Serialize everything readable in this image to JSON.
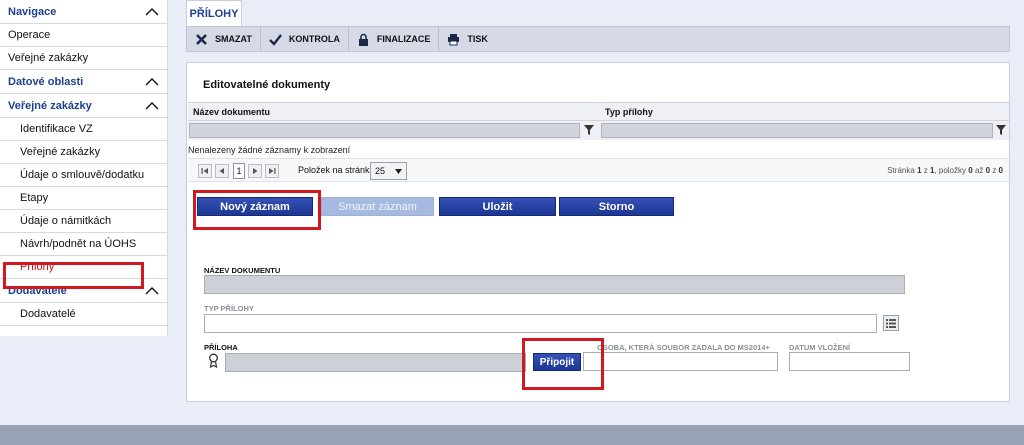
{
  "sidebar": {
    "sections": [
      {
        "title": "Navigace",
        "items": [
          {
            "label": "Operace"
          },
          {
            "label": "Veřejné zakázky"
          }
        ]
      },
      {
        "title": "Datové oblasti",
        "items": []
      },
      {
        "title": "Veřejné zakázky",
        "items": [
          {
            "label": "Identifikace VZ"
          },
          {
            "label": "Veřejné zakázky"
          },
          {
            "label": "Údaje o smlouvě/dodatku"
          },
          {
            "label": "Etapy"
          },
          {
            "label": "Údaje o námitkách"
          },
          {
            "label": "Návrh/podnět na ÚOHS"
          },
          {
            "label": "Přílohy",
            "active": true
          }
        ]
      },
      {
        "title": "Dodavatelé",
        "items": [
          {
            "label": "Dodavatelé"
          }
        ]
      }
    ]
  },
  "tab": {
    "label": "PŘÍLOHY"
  },
  "toolbar": {
    "delete": "SMAZAT",
    "check": "KONTROLA",
    "finalize": "FINALIZACE",
    "print": "TISK"
  },
  "grid": {
    "title": "Editovatelné dokumenty",
    "columns": [
      "Název dokumentu",
      "Typ přílohy"
    ],
    "empty_message": "Nenalezeny žádné záznamy k zobrazení",
    "pager": {
      "current_page": "1",
      "per_page_label": "Položek na stránku",
      "per_page_value": "25",
      "info_prefix": "Stránka",
      "page": "1",
      "info_of": "z",
      "pages": "1",
      "info_items": ", položky",
      "from": "0",
      "info_to": "až",
      "to": "0",
      "info_z": "z",
      "total": "0"
    }
  },
  "actions": {
    "new": "Nový záznam",
    "delete": "Smazat záznam",
    "save": "Uložit",
    "cancel": "Storno"
  },
  "form": {
    "doc_name_label": "NÁZEV DOKUMENTU",
    "attachment_type_label": "TYP PŘÍLOHY",
    "attachment_label": "PŘÍLOHA",
    "attach_button": "Připojit",
    "uploader_label": "OSOBA, KTERÁ SOUBOR ZADALA DO MS2014+",
    "date_label": "DATUM VLOŽENÍ"
  },
  "colors": {
    "accent": "#1f3f8f",
    "highlight": "#d31920"
  }
}
